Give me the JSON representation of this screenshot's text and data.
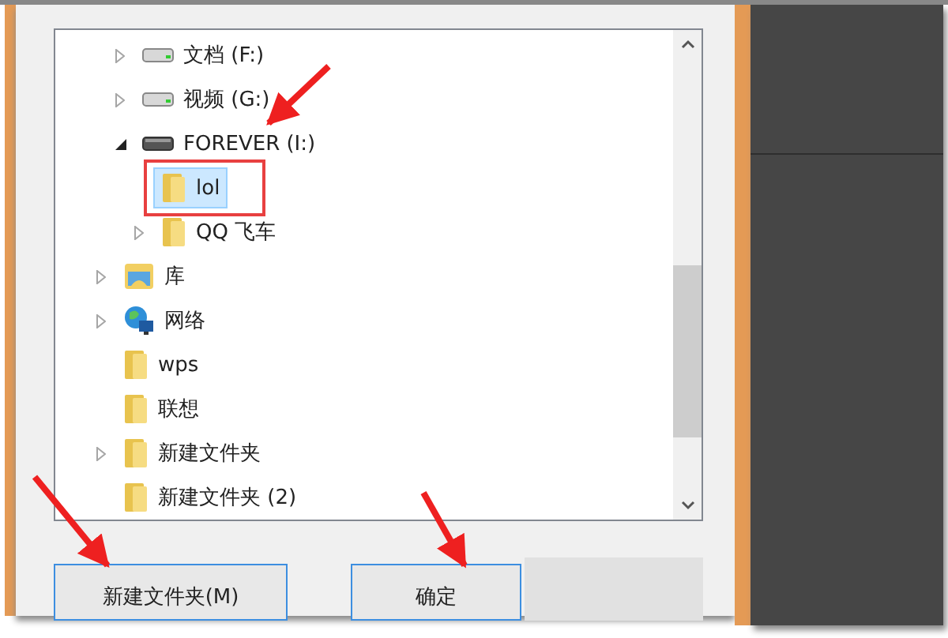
{
  "folder_tree": {
    "nested_items": [
      {
        "label": "文档 (F:)",
        "kind": "drive",
        "expandable": true,
        "expanded": false,
        "selected": false
      },
      {
        "label": "视频 (G:)",
        "kind": "drive",
        "expandable": true,
        "expanded": false,
        "selected": false
      },
      {
        "label": "FOREVER (I:)",
        "kind": "removable",
        "expandable": true,
        "expanded": true,
        "selected": false,
        "children": [
          {
            "label": "lol",
            "kind": "folder",
            "expandable": false,
            "selected": true,
            "marked": true
          },
          {
            "label": "QQ 飞车",
            "kind": "folder",
            "expandable": true,
            "expanded": false,
            "selected": false
          }
        ]
      }
    ],
    "items": [
      {
        "label": "库",
        "kind": "library",
        "expandable": true,
        "expanded": false,
        "selected": false
      },
      {
        "label": "网络",
        "kind": "network",
        "expandable": true,
        "expanded": false,
        "selected": false
      },
      {
        "label": "wps",
        "kind": "folder",
        "expandable": false,
        "selected": false
      },
      {
        "label": "联想",
        "kind": "folder",
        "expandable": false,
        "selected": false
      },
      {
        "label": "新建文件夹",
        "kind": "folder",
        "expandable": true,
        "expanded": false,
        "selected": false
      },
      {
        "label": "新建文件夹 (2)",
        "kind": "folder",
        "expandable": false,
        "selected": false
      }
    ]
  },
  "buttons": [
    {
      "label": "新建文件夹(M)",
      "kind": "text"
    },
    {
      "label": "确定",
      "kind": "text"
    },
    {
      "kind": "blank"
    }
  ]
}
